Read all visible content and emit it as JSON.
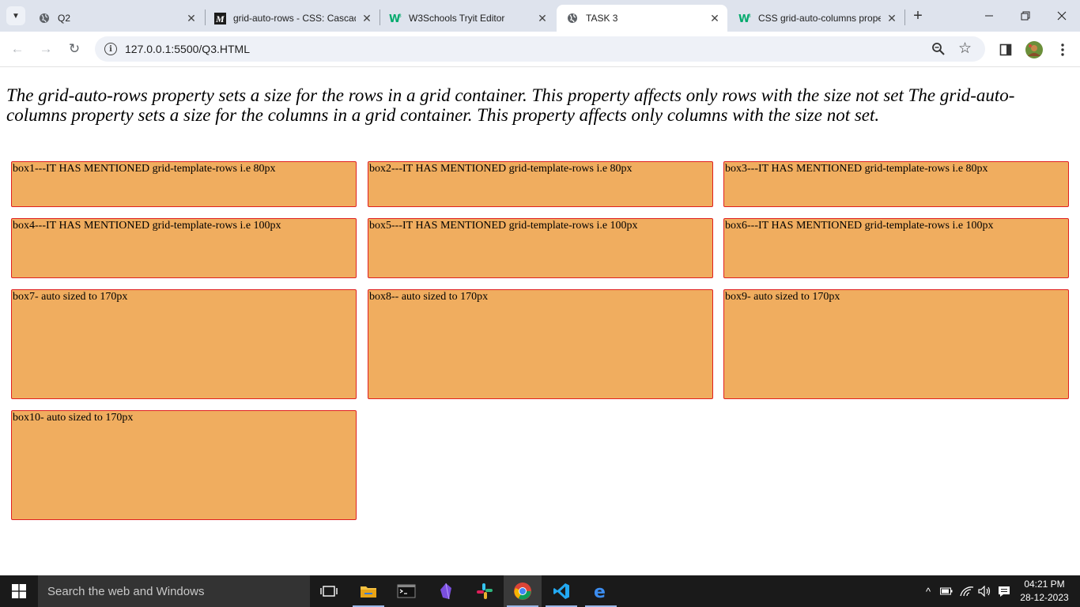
{
  "tabs": [
    {
      "title": "Q2",
      "icon": "globe-icon",
      "active": false
    },
    {
      "title": "grid-auto-rows - CSS: Cascading Style Sheets | MDN",
      "icon": "mdn-icon",
      "active": false
    },
    {
      "title": "W3Schools Tryit Editor",
      "icon": "w3schools-icon",
      "active": false
    },
    {
      "title": "TASK 3",
      "icon": "globe-icon",
      "active": true
    },
    {
      "title": "CSS grid-auto-columns property",
      "icon": "w3schools-icon",
      "active": false
    }
  ],
  "address_bar": {
    "url": "127.0.0.1:5500/Q3.HTML"
  },
  "page": {
    "intro": "The grid-auto-rows property sets a size for the rows in a grid container. This property affects only rows with the size not set The grid-auto-columns property sets a size for the columns in a grid container. This property affects only columns with the size not set.",
    "boxes": [
      {
        "label": "box1---IT HAS MENTIONED grid-template-rows i.e 80px"
      },
      {
        "label": "box2---IT HAS MENTIONED grid-template-rows i.e 80px"
      },
      {
        "label": "box3---IT HAS MENTIONED grid-template-rows i.e 80px"
      },
      {
        "label": "box4---IT HAS MENTIONED grid-template-rows i.e 100px"
      },
      {
        "label": "box5---IT HAS MENTIONED grid-template-rows i.e 100px"
      },
      {
        "label": "box6---IT HAS MENTIONED grid-template-rows i.e 100px"
      },
      {
        "label": "box7- auto sized to 170px"
      },
      {
        "label": "box8-- auto sized to 170px"
      },
      {
        "label": "box9- auto sized to 170px"
      },
      {
        "label": "box10- auto sized to 170px"
      }
    ]
  },
  "colors": {
    "box_fill": "#f0ad5f",
    "box_border": "#e02020",
    "tabstrip": "#dee3ed"
  },
  "taskbar": {
    "search_placeholder": "Search the web and Windows",
    "apps": [
      "task-view-icon",
      "file-explorer-icon",
      "terminal-icon",
      "obsidian-icon",
      "slack-icon",
      "chrome-icon",
      "vscode-icon",
      "edge-icon"
    ],
    "clock": {
      "time": "04:21 PM",
      "date": "28-12-2023"
    }
  }
}
